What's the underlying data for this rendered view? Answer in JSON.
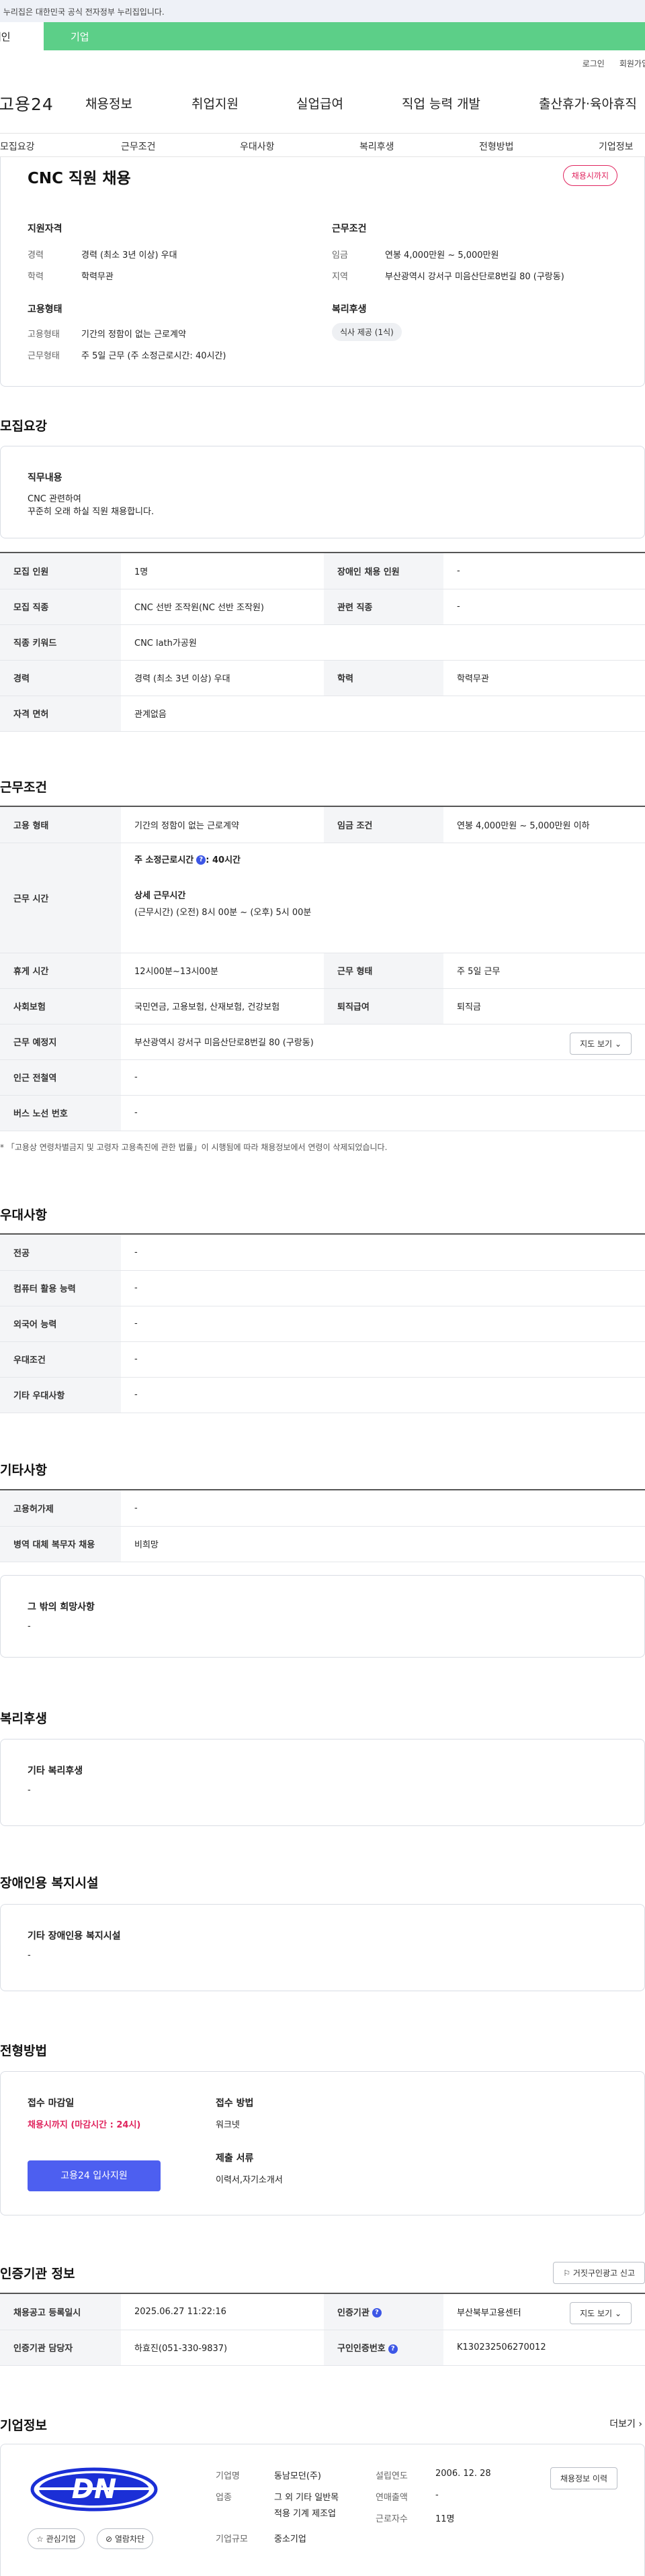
{
  "gov_banner": "이 누리집은 대한민국 공식 전자정부 누리집입니다.",
  "tabs": {
    "person": "개인",
    "company": "기업"
  },
  "util": {
    "login": "로그인",
    "join": "회원가입"
  },
  "logo": "고용24",
  "gnb": [
    "채용정보",
    "취업지원",
    "실업급여",
    "직업 능력 개발",
    "출산휴가·육아휴직"
  ],
  "subnav": [
    "모집요강",
    "근무조건",
    "우대사항",
    "복리후생",
    "전형방법",
    "기업정보"
  ],
  "summary": {
    "title": "CNC 직원 채용",
    "deadline_badge": "채용시까지",
    "qual_title": "지원자격",
    "career_label": "경력",
    "career_value": "경력 (최소 3년 이상) 우대",
    "edu_label": "학력",
    "edu_value": "학력무관",
    "work_title": "근무조건",
    "wage_label": "임금",
    "wage_value": "연봉 4,000만원 ~ 5,000만원",
    "region_label": "지역",
    "region_value": "부산광역시 강서구 미음산단로8번길 80 (구랑동)",
    "emp_title": "고용형태",
    "emptype_label": "고용형태",
    "emptype_value": "기간의 정함이 없는 근로계약",
    "worktype_label": "근무형태",
    "worktype_value": "주 5일 근무 (주 소정근로시간: 40시간)",
    "welfare_title": "복리후생",
    "welfare_chip": "식사 제공 (1식)"
  },
  "recruit": {
    "section": "모집요강",
    "duty_title": "직무내용",
    "duty_line1": "CNC 관련하여",
    "duty_line2": "꾸준히 오래 하실 직원 채용합니다.",
    "rows": {
      "count_label": "모집 인원",
      "count_value": "1명",
      "disabled_label": "장애인 채용 인원",
      "disabled_value": "-",
      "job_label": "모집 직종",
      "job_value": "CNC 선반 조작원(NC 선반 조작원)",
      "related_label": "관련 직종",
      "related_value": "-",
      "keyword_label": "직종 키워드",
      "keyword_value": "CNC lath가공원",
      "career_label": "경력",
      "career_value": "경력 (최소 3년 이상) 우대",
      "edu_label": "학력",
      "edu_value": "학력무관",
      "license_label": "자격 면허",
      "license_value": "관계없음"
    }
  },
  "conditions": {
    "section": "근무조건",
    "emptype_label": "고용 형태",
    "emptype_value": "기간의 정함이 없는 근로계약",
    "wage_label": "임금 조건",
    "wage_value": "연봉 4,000만원 ~ 5,000만원 이하",
    "hours_label": "근무 시간",
    "hours_weekly": "주 소정근로시간",
    "hours_weekly_value": ": 40시간",
    "hours_detail_title": "상세 근무시간",
    "hours_detail_value": "(근무시간) (오전) 8시 00분 ~ (오후) 5시 00분",
    "break_label": "휴게 시간",
    "break_value": "12시00분~13시00분",
    "workform_label": "근무 형태",
    "workform_value": "주 5일 근무",
    "insurance_label": "사회보험",
    "insurance_value": "국민연금, 고용보험, 산재보험, 건강보험",
    "retire_label": "퇴직급여",
    "retire_value": "퇴직금",
    "place_label": "근무 예정지",
    "place_value": "부산광역시 강서구 미음산단로8번길 80 (구랑동)",
    "map_button": "지도 보기",
    "subway_label": "인근 전철역",
    "subway_value": "-",
    "bus_label": "버스 노선 번호",
    "bus_value": "-",
    "note": "* 「고용상 연령차별금지 및 고령자 고용촉진에 관한 법률」이 시행됨에 따라 채용정보에서 연령이 삭제되었습니다."
  },
  "preference": {
    "section": "우대사항",
    "rows": [
      {
        "label": "전공",
        "value": "-"
      },
      {
        "label": "컴퓨터 활용 능력",
        "value": "-"
      },
      {
        "label": "외국어 능력",
        "value": "-"
      },
      {
        "label": "우대조건",
        "value": "-"
      },
      {
        "label": "기타 우대사항",
        "value": "-"
      }
    ]
  },
  "etc": {
    "section": "기타사항",
    "rows": [
      {
        "label": "고용허가제",
        "value": "-"
      },
      {
        "label": "병역 대체 복무자 채용",
        "value": "비희망"
      }
    ],
    "hope_title": "그 밖의 희망사항",
    "hope_value": "-"
  },
  "welfare": {
    "section": "복리후생",
    "title": "기타 복리후생",
    "value": "-"
  },
  "disabled_facility": {
    "section": "장애인용 복지시설",
    "title": "기타 장애인용 복지시설",
    "value": "-"
  },
  "process": {
    "section": "전형방법",
    "deadline_title": "접수 마감일",
    "deadline_value": "채용시까지 (마감시간 : 24시)",
    "apply_button": "고용24 입사지원",
    "method_title": "접수 방법",
    "method_value": "워크넷",
    "docs_title": "제출 서류",
    "docs_value": "이력서,자기소개서"
  },
  "cert": {
    "section": "인증기관 정보",
    "report_button": "거짓구인광고 신고",
    "regdate_label": "채용공고 등록일시",
    "regdate_value": "2025.06.27 11:22:16",
    "org_label": "인증기관",
    "org_value": "부산북부고용센터",
    "map_button": "지도 보기",
    "manager_label": "인증기관 담당자",
    "manager_value": "하효진(051-330-9837)",
    "certno_label": "구인인증번호",
    "certno_value": "K130232506270012"
  },
  "company": {
    "section": "기업정보",
    "more": "더보기",
    "logo_text": "DN",
    "fav_button": "관심기업",
    "block_button": "열람차단",
    "name_label": "기업명",
    "name_value": "동남모던(주)",
    "industry_label": "업종",
    "industry_line1": "그 외 기타 일반목",
    "industry_line2": "적용 기계 제조업",
    "size_label": "기업규모",
    "size_value": "중소기업",
    "founded_label": "설립연도",
    "founded_value": "2006. 12. 28",
    "sales_label": "연매출액",
    "sales_value": "-",
    "employees_label": "근로자수",
    "employees_value": "11명",
    "history_button": "채용정보 이력"
  },
  "colors": {
    "accent_green": "#5ccf88",
    "primary_blue": "#4d5ff0",
    "deadline_red": "#e0245e",
    "logo_blue": "#1b2fd6"
  }
}
